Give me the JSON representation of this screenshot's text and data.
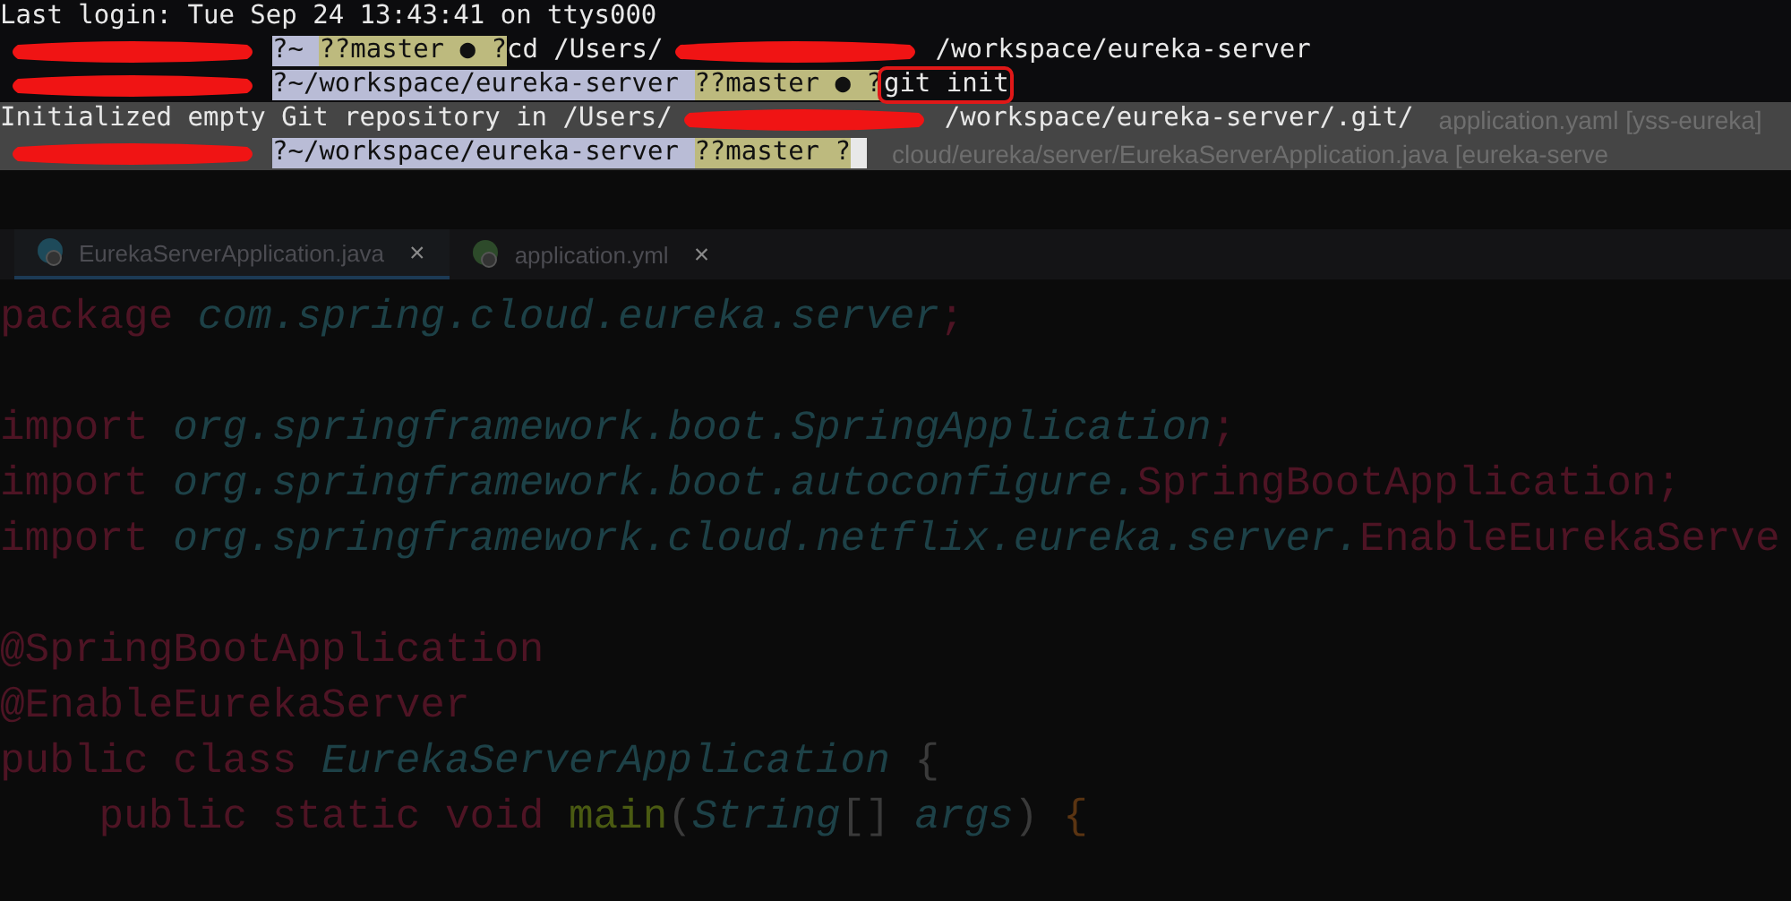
{
  "terminal": {
    "lines": [
      {
        "segments": [
          {
            "kind": "plain",
            "text": "Last login: Tue Sep 24 13:43:41 on ttys000"
          }
        ]
      },
      {
        "segments": [
          {
            "kind": "redacted"
          },
          {
            "kind": "dir",
            "text": "?~ "
          },
          {
            "kind": "git",
            "text": "??master ● ?"
          },
          {
            "kind": "plain",
            "text": "cd /Users/"
          },
          {
            "kind": "redacted"
          },
          {
            "kind": "plain",
            "text": "/workspace/eureka-server"
          }
        ]
      },
      {
        "segments": [
          {
            "kind": "redacted"
          },
          {
            "kind": "dir",
            "text": "?~/workspace/eureka-server "
          },
          {
            "kind": "git",
            "text": "??master ● ?"
          },
          {
            "kind": "command",
            "text": "git init"
          }
        ]
      },
      {
        "segments": [
          {
            "kind": "plain",
            "text": "Initialized empty Git repository in /Users/"
          },
          {
            "kind": "redacted"
          },
          {
            "kind": "plain",
            "text": "/workspace/eureka-server/.git/"
          },
          {
            "kind": "ghost",
            "text": "application.yaml [yss-eureka]"
          }
        ]
      },
      {
        "segments": [
          {
            "kind": "redacted"
          },
          {
            "kind": "dir",
            "text": "?~/workspace/eureka-server "
          },
          {
            "kind": "git",
            "text": "??master ?"
          },
          {
            "kind": "cursor"
          },
          {
            "kind": "ghost",
            "text": "cloud/eureka/server/EurekaServerApplication.java [eureka-serve"
          }
        ]
      }
    ]
  },
  "editor": {
    "tabs": [
      {
        "label": "EurekaServerApplication.java",
        "close": "×",
        "selected": true
      },
      {
        "label": "application.yml",
        "close": "×",
        "selected": false
      }
    ],
    "code": [
      {
        "kind": "code",
        "tokens": [
          {
            "kind": "keyword",
            "text": "package "
          },
          {
            "kind": "type",
            "text": "com.spring.cloud.eureka.server"
          },
          {
            "kind": "keyword",
            "text": ";"
          }
        ]
      },
      {
        "kind": "blank"
      },
      {
        "kind": "code",
        "tokens": [
          {
            "kind": "keyword",
            "text": "import "
          },
          {
            "kind": "type",
            "text": "org.springframework.boot.SpringApplication"
          },
          {
            "kind": "keyword",
            "text": ";"
          }
        ]
      },
      {
        "kind": "code",
        "tokens": [
          {
            "kind": "keyword",
            "text": "import "
          },
          {
            "kind": "type",
            "text": "org.springframework.boot.autoconfigure."
          },
          {
            "kind": "keyword",
            "text": "SpringBootApplication;"
          }
        ]
      },
      {
        "kind": "code",
        "tokens": [
          {
            "kind": "keyword",
            "text": "import "
          },
          {
            "kind": "type",
            "text": "org.springframework.cloud.netflix.eureka.server."
          },
          {
            "kind": "keyword",
            "text": "EnableEurekaServe"
          }
        ]
      },
      {
        "kind": "blank"
      },
      {
        "kind": "code",
        "tokens": [
          {
            "kind": "keyword",
            "text": "@SpringBootApplication"
          }
        ]
      },
      {
        "kind": "code",
        "tokens": [
          {
            "kind": "keyword",
            "text": "@EnableEurekaServer"
          }
        ]
      },
      {
        "kind": "code",
        "tokens": [
          {
            "kind": "keyword",
            "text": "public class "
          },
          {
            "kind": "type",
            "text": "EurekaServerApplication"
          },
          {
            "kind": "plain",
            "text": " {"
          }
        ]
      },
      {
        "kind": "code",
        "tokens": [
          {
            "kind": "keyword",
            "text": "    public static void "
          },
          {
            "kind": "method",
            "text": "main"
          },
          {
            "kind": "plain",
            "text": "("
          },
          {
            "kind": "type",
            "text": "String"
          },
          {
            "kind": "plain",
            "text": "[] "
          },
          {
            "kind": "type",
            "text": "args"
          },
          {
            "kind": "plain",
            "text": ") "
          },
          {
            "kind": "brace",
            "text": "{"
          }
        ]
      }
    ]
  }
}
